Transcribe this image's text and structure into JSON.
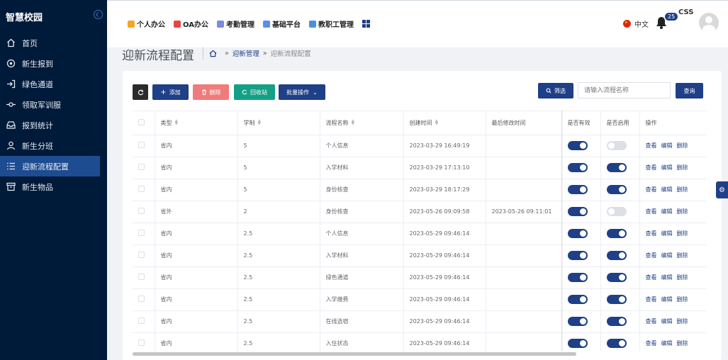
{
  "app": {
    "title": "智慧校园"
  },
  "sidebar": {
    "items": [
      {
        "label": "首页",
        "icon": "home-icon"
      },
      {
        "label": "新生报到",
        "icon": "target-icon"
      },
      {
        "label": "绿色通道",
        "icon": "enter-icon"
      },
      {
        "label": "领取军训服",
        "icon": "commit-icon"
      },
      {
        "label": "报到统计",
        "icon": "inbox-icon"
      },
      {
        "label": "新生分班",
        "icon": "user-icon"
      },
      {
        "label": "迎新流程配置",
        "icon": "list-icon",
        "active": true
      },
      {
        "label": "新生物品",
        "icon": "box-icon"
      }
    ]
  },
  "topnav": {
    "items": [
      {
        "label": "个人办公",
        "color": "#f5a623"
      },
      {
        "label": "OA办公",
        "color": "#e64545"
      },
      {
        "label": "考勤管理",
        "color": "#7b8cde"
      },
      {
        "label": "基础平台",
        "color": "#5b8def"
      },
      {
        "label": "教职工管理",
        "color": "#4a90e2"
      }
    ],
    "language": "中文",
    "notification_count": "25",
    "extra_label": "CSS"
  },
  "page": {
    "title": "迎新流程配置",
    "breadcrumb": [
      "迎新管理",
      "迎新流程配置"
    ]
  },
  "toolbar": {
    "add_label": "添加",
    "delete_label": "删除",
    "recycle_label": "回收站",
    "batch_label": "批量操作",
    "filter_label": "筛选",
    "search_placeholder": "请输入流程名称",
    "search_label": "查询"
  },
  "table": {
    "headers": [
      "类型",
      "学制",
      "流程名称",
      "创建时间",
      "最后修改时间",
      "是否有效",
      "是否启用",
      "操作"
    ],
    "actions": [
      "查看",
      "编辑",
      "删除"
    ],
    "rows": [
      {
        "type": "省内",
        "duration": "5",
        "name": "个人信息",
        "created": "2023-03-29 16:49:19",
        "modified": "",
        "valid": true,
        "enabled": false
      },
      {
        "type": "省内",
        "duration": "5",
        "name": "入学材料",
        "created": "2023-03-29 17:13:10",
        "modified": "",
        "valid": true,
        "enabled": true
      },
      {
        "type": "省内",
        "duration": "5",
        "name": "身份核查",
        "created": "2023-03-29 18:17:29",
        "modified": "",
        "valid": true,
        "enabled": true
      },
      {
        "type": "省外",
        "duration": "2",
        "name": "身份核查",
        "created": "2023-05-26 09:09:58",
        "modified": "2023-05-26 09:11:01",
        "valid": true,
        "enabled": false
      },
      {
        "type": "省内",
        "duration": "2.5",
        "name": "个人信息",
        "created": "2023-05-29 09:46:14",
        "modified": "",
        "valid": true,
        "enabled": true
      },
      {
        "type": "省内",
        "duration": "2.5",
        "name": "入学材料",
        "created": "2023-05-29 09:46:14",
        "modified": "",
        "valid": true,
        "enabled": true
      },
      {
        "type": "省内",
        "duration": "2.5",
        "name": "绿色通道",
        "created": "2023-05-29 09:46:14",
        "modified": "",
        "valid": true,
        "enabled": true
      },
      {
        "type": "省内",
        "duration": "2.5",
        "name": "入学缴费",
        "created": "2023-05-29 09:46:14",
        "modified": "",
        "valid": true,
        "enabled": true
      },
      {
        "type": "省内",
        "duration": "2.5",
        "name": "在线选宿",
        "created": "2023-05-29 09:46:14",
        "modified": "",
        "valid": true,
        "enabled": true
      },
      {
        "type": "省内",
        "duration": "2.5",
        "name": "入住状态",
        "created": "2023-05-29 09:46:14",
        "modified": "",
        "valid": true,
        "enabled": true
      }
    ]
  },
  "colors": {
    "primary": "#1f3f87",
    "sidebar_bg": "#001a3a",
    "danger": "#f07b7b",
    "success": "#14a085"
  }
}
